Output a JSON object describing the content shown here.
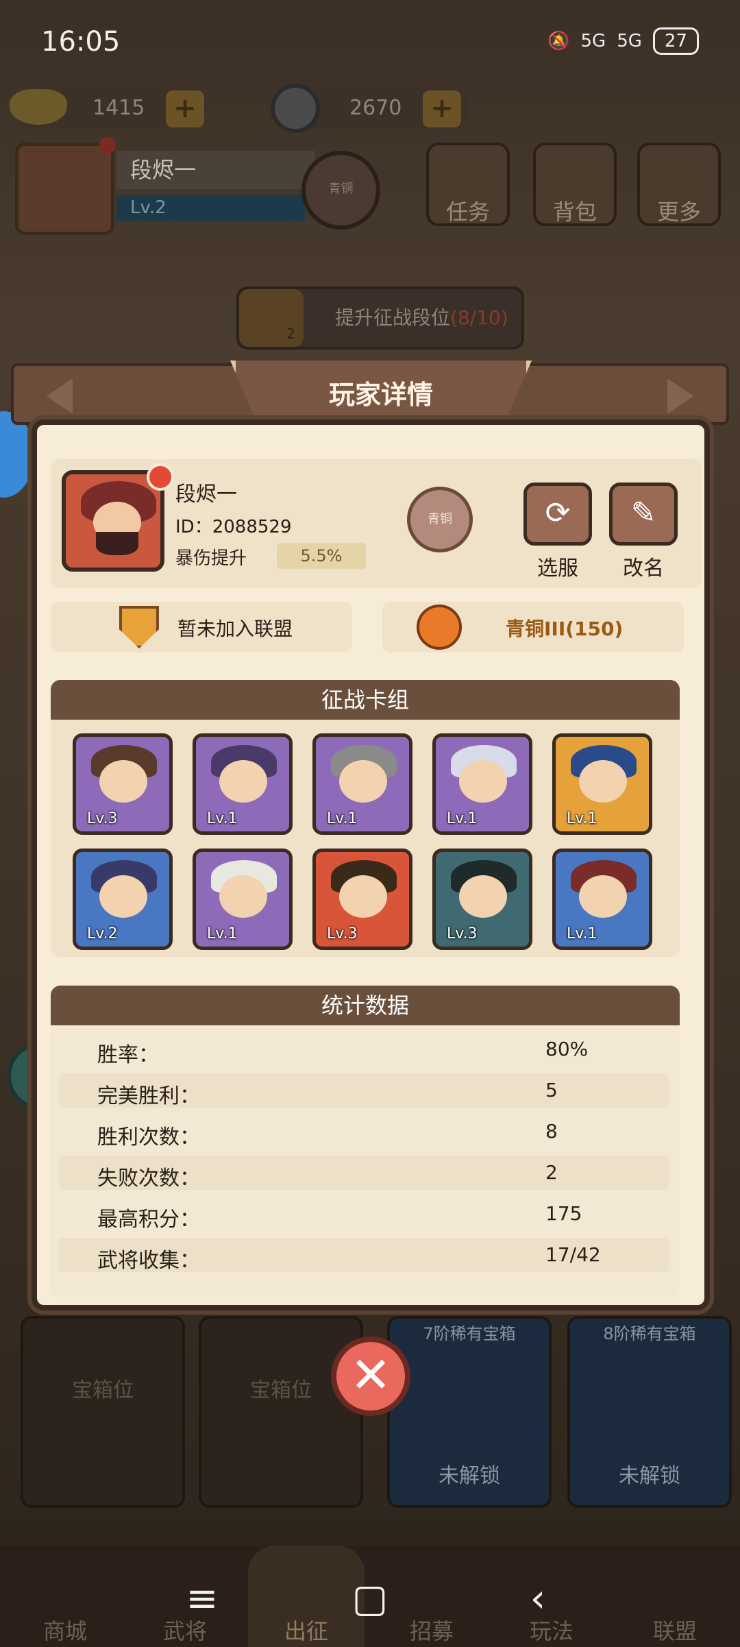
{
  "status_bar": {
    "time": "16:05",
    "signal1": "5G",
    "signal2": "5G",
    "battery": "27"
  },
  "resources": {
    "gold": "1415",
    "coins": "2670"
  },
  "mini_profile": {
    "name": "段烬一",
    "level": "Lv.2",
    "rank_glyph": "青铜"
  },
  "menu": {
    "task": "任务",
    "bag": "背包",
    "more": "更多"
  },
  "upgrade": {
    "label": "提升征战段位",
    "progress": "(8/10)",
    "badge": "2"
  },
  "modal": {
    "title": "玩家详情",
    "player": {
      "name": "段烬一",
      "id_label": "ID：2088529",
      "crit_label": "暴伤提升",
      "crit_value": "5.5%",
      "rank_glyph": "青铜"
    },
    "actions": {
      "server": "选服",
      "rename": "改名"
    },
    "alliance": "暂未加入联盟",
    "rank_text": "青铜III(150)",
    "deck_title": "征战卡组",
    "deck": [
      {
        "lv": "Lv.3",
        "rarity": "purple"
      },
      {
        "lv": "Lv.1",
        "rarity": "purple"
      },
      {
        "lv": "Lv.1",
        "rarity": "purple"
      },
      {
        "lv": "Lv.1",
        "rarity": "purple"
      },
      {
        "lv": "Lv.1",
        "rarity": "gold"
      },
      {
        "lv": "Lv.2",
        "rarity": "blue"
      },
      {
        "lv": "Lv.1",
        "rarity": "purple"
      },
      {
        "lv": "Lv.3",
        "rarity": "blue"
      },
      {
        "lv": "Lv.3",
        "rarity": "blue"
      },
      {
        "lv": "Lv.1",
        "rarity": "blue"
      }
    ],
    "stats_title": "统计数据",
    "stats": [
      {
        "label": "胜率：",
        "value": "80%"
      },
      {
        "label": "完美胜利：",
        "value": "5"
      },
      {
        "label": "胜利次数：",
        "value": "8"
      },
      {
        "label": "失败次数：",
        "value": "2"
      },
      {
        "label": "最高积分：",
        "value": "175"
      },
      {
        "label": "武将收集：",
        "value": "17/42"
      }
    ]
  },
  "chests": {
    "slot1": "宝箱位",
    "slot2": "宝箱位",
    "slot3_cap": "7阶稀有宝箱",
    "slot3": "未解锁",
    "slot4_cap": "8阶稀有宝箱",
    "slot4": "未解锁"
  },
  "bottom_nav": [
    "商城",
    "武将",
    "出征",
    "招募",
    "玩法",
    "联盟"
  ],
  "colors": {
    "accent_brown": "#6a4f3d",
    "panel_bg": "#f6ecd8",
    "rank_text": "#9a5a12",
    "close_red": "#e9695e"
  }
}
